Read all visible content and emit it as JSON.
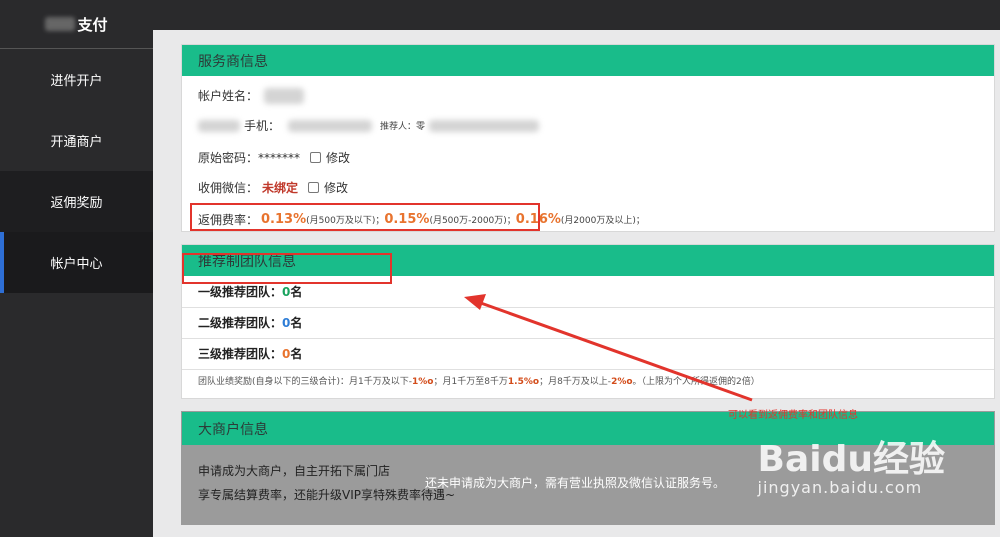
{
  "sidebar": {
    "logo": "支付",
    "items": [
      {
        "label": "进件开户"
      },
      {
        "label": "开通商户"
      },
      {
        "label": "返佣奖励"
      },
      {
        "label": "帐户中心"
      }
    ]
  },
  "provider": {
    "title": "服务商信息",
    "account_name_label": "帐户姓名：",
    "phone_label": "手机：",
    "referrer_label": "推荐人：零",
    "password_label": "原始密码：",
    "password_value": "*******",
    "modify_label": "修改",
    "wechat_label": "收佣微信：",
    "wechat_value": "未绑定",
    "rate_label": "返佣费率：",
    "rates": [
      {
        "value": "0.13%",
        "note": "(月500万及以下)；"
      },
      {
        "value": "0.15%",
        "note": "(月500万-2000万)；"
      },
      {
        "value": "0.16%",
        "note": "(月2000万及以上)；"
      }
    ]
  },
  "team": {
    "title": "推荐制团队信息",
    "rows": [
      {
        "label": "一级推荐团队：",
        "count": "0",
        "unit": "名"
      },
      {
        "label": "二级推荐团队：",
        "count": "0",
        "unit": "名"
      },
      {
        "label": "三级推荐团队：",
        "count": "0",
        "unit": "名"
      }
    ],
    "footnote_a": "团队业绩奖励(自身以下的三级合计)：月1千万及以下-",
    "footnote_r1": "1%o",
    "footnote_b": "；月1千万至8千万",
    "footnote_r2": "1.5%o",
    "footnote_c": "；月8千万及以上-",
    "footnote_r3": "2%o",
    "footnote_d": "。（上限为个人所得返佣的2倍）"
  },
  "merchant": {
    "title": "大商户信息",
    "line1": "申请成为大商户，自主开拓下属门店",
    "line2": "享专属结算费率，还能升级VIP享特殊费率待遇~",
    "overlay": "还未申请成为大商户，需有营业执照及微信认证服务号。"
  },
  "annotation": {
    "note": "可以看到返佣费率和团队信息"
  },
  "watermark": {
    "brand": "Baidu经验",
    "url": "jingyan.baidu.com"
  }
}
